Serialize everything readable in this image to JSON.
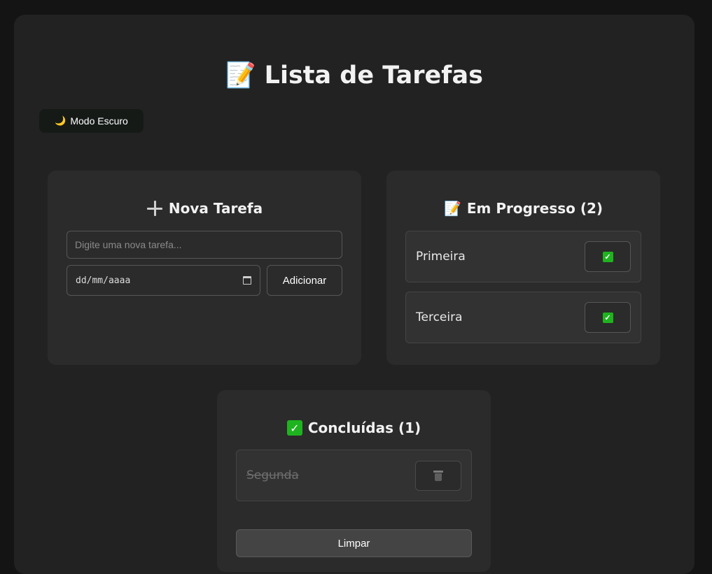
{
  "header": {
    "title": "Lista de Tarefas",
    "title_icon": "memo-icon",
    "title_emoji": "📝"
  },
  "theme_toggle": {
    "label": "Modo Escuro",
    "icon": "moon-icon",
    "emoji": "🌙"
  },
  "new_task": {
    "title": "Nova Tarefa",
    "input_placeholder": "Digite uma nova tarefa...",
    "date_placeholder": "dd/mm/aaaa",
    "add_label": "Adicionar"
  },
  "in_progress": {
    "title": "Em Progresso (2)",
    "emoji": "📝",
    "items": [
      {
        "label": "Primeira"
      },
      {
        "label": "Terceira"
      }
    ]
  },
  "done": {
    "title": "Concluídas (1)",
    "items": [
      {
        "label": "Segunda"
      }
    ],
    "clear_label": "Limpar"
  },
  "colors": {
    "background": "#141414",
    "panel": "#222222",
    "card": "#2b2b2b",
    "check_green": "#1fb31f"
  }
}
